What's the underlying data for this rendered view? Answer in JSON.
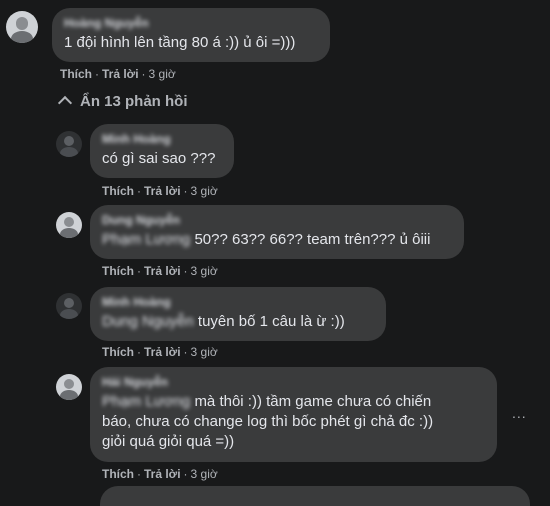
{
  "comments": [
    {
      "author": "Hoàng Nguyễn",
      "text": "1 đội hình lên tầng 80 á :)) ủ ôi =)))",
      "like": "Thích",
      "reply": "Trả lời",
      "time": "3 giờ"
    }
  ],
  "toggle_label": "Ẩn 13 phản hồi",
  "replies": [
    {
      "author": "Minh Hoàng",
      "text": "có gì sai sao ???",
      "like": "Thích",
      "reply": "Trả lời",
      "time": "3 giờ"
    },
    {
      "author": "Dung Nguyễn",
      "mention": "Phạm Lương",
      "text": "50?? 63?? 66?? team trên??? ủ ôiii",
      "like": "Thích",
      "reply": "Trả lời",
      "time": "3 giờ"
    },
    {
      "author": "Minh Hoàng",
      "mention": "Dung Nguyễn",
      "text": "tuyên bố 1 câu là ừ :))",
      "like": "Thích",
      "reply": "Trả lời",
      "time": "3 giờ"
    },
    {
      "author": "Hải Nguyễn",
      "mention": "Phạm Lương",
      "text": "mà thôi :)) tầm game chưa có chiến\nbáo, chưa có change log thì bốc phét gì chả đc :))\ngiỏi quá giỏi quá =))",
      "like": "Thích",
      "reply": "Trả lời",
      "time": "3 giờ"
    }
  ],
  "more_options": "..."
}
